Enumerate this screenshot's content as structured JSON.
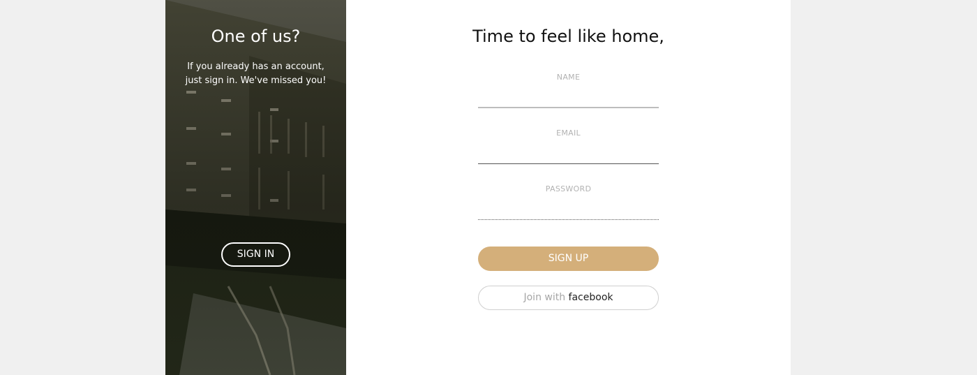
{
  "side_panel": {
    "title": "One of us?",
    "text_line1": "If you already has an account,",
    "text_line2": "just sign in. We've missed you!",
    "signin_label": "SIGN IN"
  },
  "form": {
    "title": "Time to feel like home,",
    "name_label": "NAME",
    "email_label": "EMAIL",
    "password_label": "PASSWORD",
    "signup_label": "SIGN UP",
    "facebook_prefix": "Join with",
    "facebook_brand": "facebook"
  },
  "colors": {
    "accent": "#d4af7a",
    "page_background": "#f0f0f0",
    "card_background": "#ffffff"
  }
}
